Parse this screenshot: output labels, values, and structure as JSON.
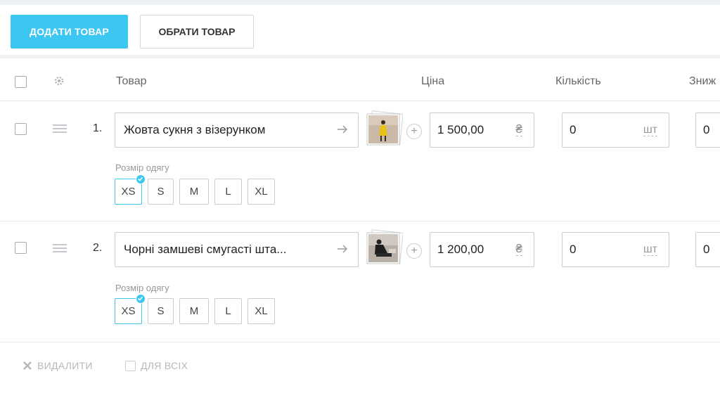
{
  "toolbar": {
    "add_label": "ДОДАТИ ТОВАР",
    "choose_label": "ОБРАТИ ТОВАР"
  },
  "table": {
    "headers": {
      "product": "Товар",
      "price": "Ціна",
      "quantity": "Кількість",
      "discount": "Зниж"
    }
  },
  "products": [
    {
      "index": "1.",
      "name": "Жовта сукня з візерунком",
      "price": "1 500,00",
      "currency": "₴",
      "quantity": "0",
      "unit": "шт",
      "discount": "0",
      "size_label": "Розмір одягу",
      "sizes": [
        "XS",
        "S",
        "M",
        "L",
        "XL"
      ],
      "selected_size": "XS"
    },
    {
      "index": "2.",
      "name": "Чорні замшеві смугасті шта...",
      "price": "1 200,00",
      "currency": "₴",
      "quantity": "0",
      "unit": "шт",
      "discount": "0",
      "size_label": "Розмір одягу",
      "sizes": [
        "XS",
        "S",
        "M",
        "L",
        "XL"
      ],
      "selected_size": "XS"
    }
  ],
  "footer": {
    "delete_label": "ВИДАЛИТИ",
    "for_all_label": "ДЛЯ ВСІХ"
  },
  "colors": {
    "accent": "#3cc6f2",
    "border": "#c9cdd2",
    "muted": "#b4b8bc"
  },
  "icons": [
    "gear-icon",
    "drag-handle-icon",
    "arrow-right-icon",
    "plus-icon",
    "close-icon",
    "check-icon"
  ]
}
